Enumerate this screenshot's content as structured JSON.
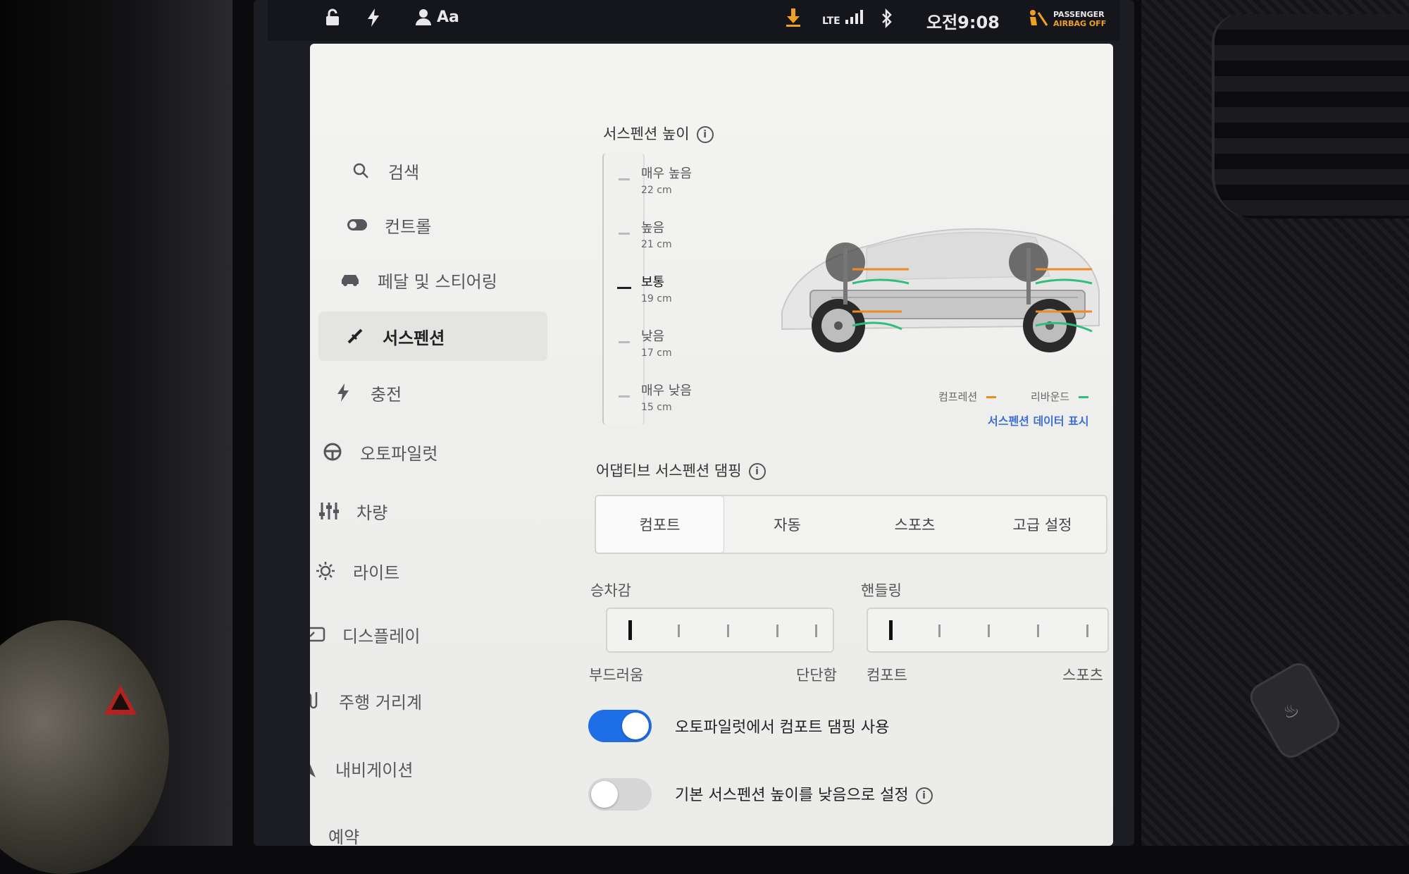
{
  "status_bar": {
    "lte": "LTE",
    "time": "오전9:08",
    "profile_label": "Aa",
    "airbag": [
      "PASSENGER",
      "AIRBAG OFF"
    ]
  },
  "sidebar": {
    "items": [
      {
        "label": "검색",
        "icon": "search-icon"
      },
      {
        "label": "컨트롤",
        "icon": "toggle-icon"
      },
      {
        "label": "페달 및 스티어링",
        "icon": "car-icon"
      },
      {
        "label": "서스펜션",
        "icon": "suspension-icon",
        "active": true
      },
      {
        "label": "충전",
        "icon": "bolt-icon"
      },
      {
        "label": "오토파일럿",
        "icon": "steering-wheel-icon"
      },
      {
        "label": "차량",
        "icon": "sliders-icon"
      },
      {
        "label": "라이트",
        "icon": "sun-icon"
      },
      {
        "label": "디스플레이",
        "icon": "display-icon"
      },
      {
        "label": "주행 거리계",
        "icon": "trip-icon"
      },
      {
        "label": "내비게이션",
        "icon": "navigation-icon"
      },
      {
        "label": "예약",
        "icon": "clock-icon"
      }
    ]
  },
  "suspension_height": {
    "title": "서스펜션 높이",
    "levels": [
      {
        "name": "매우 높음",
        "value": "22 cm"
      },
      {
        "name": "높음",
        "value": "21 cm"
      },
      {
        "name": "보통",
        "value": "19 cm",
        "selected": true
      },
      {
        "name": "낮음",
        "value": "17 cm"
      },
      {
        "name": "매우 낮음",
        "value": "15 cm"
      }
    ]
  },
  "visualization": {
    "compression": "컴프레션",
    "rebound": "리바운드",
    "compression_color": "#f08a24",
    "rebound_color": "#2fbf7a",
    "show_data": "서스펜션 데이터 표시"
  },
  "damping": {
    "title": "어댑티브 서스펜션 댐핑",
    "modes": [
      "컴포트",
      "자동",
      "스포츠",
      "고급 설정"
    ],
    "selected": "컴포트"
  },
  "advanced": {
    "ride_label": "승차감",
    "ride_min": "부드러움",
    "ride_max": "단단함",
    "ride_level": 0,
    "handling_label": "핸들링",
    "handling_min": "컴포트",
    "handling_max": "스포츠",
    "handling_level": 0
  },
  "toggles": [
    {
      "label": "오토파일럿에서 컴포트 댐핑 사용",
      "on": true
    },
    {
      "label": "기본 서스펜션 높이를 낮음으로 설정",
      "on": false
    }
  ],
  "colors": {
    "accent": "#1e6ee8"
  }
}
